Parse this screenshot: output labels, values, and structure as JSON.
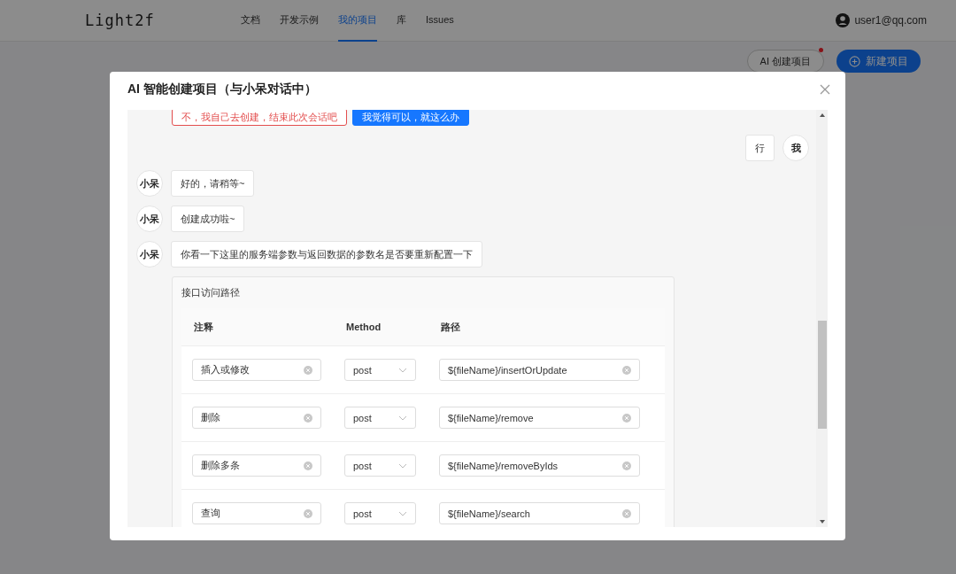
{
  "header": {
    "logo": "Light2f",
    "nav": [
      {
        "label": "文档",
        "selected": false
      },
      {
        "label": "开发示例",
        "selected": false
      },
      {
        "label": "我的项目",
        "selected": true
      },
      {
        "label": "库",
        "selected": false
      },
      {
        "label": "Issues",
        "selected": false
      }
    ],
    "user": "user1@qq.com"
  },
  "page_actions": {
    "ai_button": {
      "label": "AI 创建项目",
      "badge": true
    },
    "new_button": "新建项目"
  },
  "dialog": {
    "title": "AI 智能创建项目（与小呆对话中）",
    "options": [
      {
        "label": "不，我自己去创建，结束此次会话吧",
        "kind": "danger"
      },
      {
        "label": "我觉得可以，就这么办",
        "kind": "primary"
      }
    ],
    "messages": [
      {
        "kind": "user",
        "avatar": "我",
        "text": "行"
      },
      {
        "kind": "bot",
        "avatar": "小呆",
        "text": "好的，请稍等~"
      },
      {
        "kind": "bot",
        "avatar": "小呆",
        "text": "创建成功啦~"
      },
      {
        "kind": "bot",
        "avatar": "小呆",
        "text": "你看一下这里的服务端参数与返回数据的参数名是否要重新配置一下"
      }
    ],
    "api_table": {
      "title": "接口访问路径",
      "columns": [
        "注释",
        "Method",
        "路径"
      ],
      "rows": [
        {
          "comment": "插入或修改",
          "method": "post",
          "path": "${fileName}/insertOrUpdate"
        },
        {
          "comment": "删除",
          "method": "post",
          "path": "${fileName}/remove"
        },
        {
          "comment": "删除多条",
          "method": "post",
          "path": "${fileName}/removeByIds"
        },
        {
          "comment": "查询",
          "method": "post",
          "path": "${fileName}/search"
        }
      ]
    }
  }
}
